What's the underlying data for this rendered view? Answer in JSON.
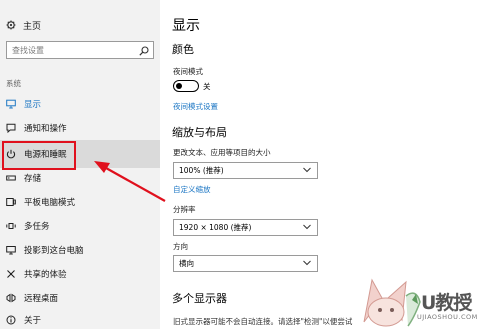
{
  "sidebar": {
    "home_label": "主页",
    "search_placeholder": "查找设置",
    "section_label": "系统",
    "items": [
      {
        "label": "显示",
        "icon": "monitor-icon"
      },
      {
        "label": "通知和操作",
        "icon": "notification-icon"
      },
      {
        "label": "电源和睡眠",
        "icon": "power-icon"
      },
      {
        "label": "存储",
        "icon": "storage-icon"
      },
      {
        "label": "平板电脑模式",
        "icon": "tablet-mode-icon"
      },
      {
        "label": "多任务",
        "icon": "multitask-icon"
      },
      {
        "label": "投影到这台电脑",
        "icon": "project-icon"
      },
      {
        "label": "共享的体验",
        "icon": "shared-experience-icon"
      },
      {
        "label": "远程桌面",
        "icon": "remote-desktop-icon"
      },
      {
        "label": "关于",
        "icon": "about-icon"
      }
    ],
    "active_item": "显示",
    "highlighted_item": "电源和睡眠"
  },
  "main": {
    "page_title": "显示",
    "color_section": "颜色",
    "night_mode_label": "夜间模式",
    "night_mode_state": "关",
    "night_mode_settings_link": "夜间模式设置",
    "scale_section": "缩放与布局",
    "scale_label": "更改文本、应用等项目的大小",
    "scale_value": "100% (推荐)",
    "custom_scale_link": "自定义缩放",
    "resolution_label": "分辨率",
    "resolution_value": "1920 × 1080 (推荐)",
    "orientation_label": "方向",
    "orientation_value": "横向",
    "multi_display_section": "多个显示器",
    "multi_display_text": "旧式显示器可能不会自动连接。请选择\"检测\"以便尝试"
  },
  "watermark": {
    "brand": "U教授",
    "domain": "UJIAOSHOU.COM"
  },
  "colors": {
    "accent": "#1d77c4",
    "highlight_box": "#e0101d",
    "sidebar_bg": "#f2f2f2"
  }
}
